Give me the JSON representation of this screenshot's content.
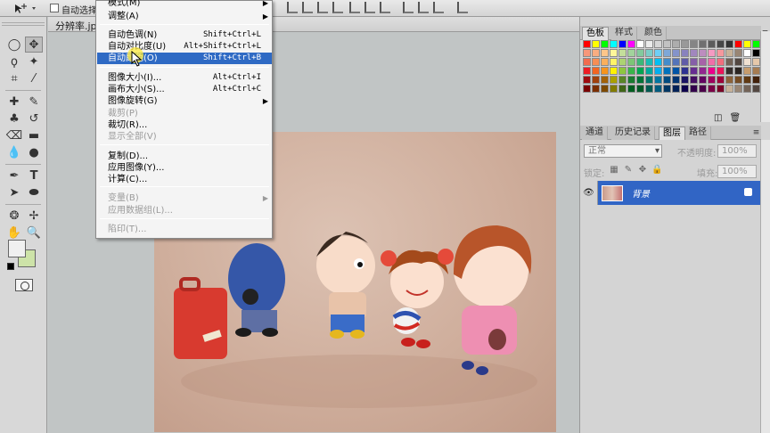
{
  "options_bar": {
    "auto_select_label": "自动选择"
  },
  "document": {
    "tab_title": "分辨率.jpg"
  },
  "image_menu": {
    "items": [
      {
        "label": "模式(M)",
        "shortcut": "",
        "submenu": true,
        "disabled": false,
        "highlight": false
      },
      {
        "label": "调整(A)",
        "shortcut": "",
        "submenu": true,
        "disabled": false,
        "highlight": false
      },
      {
        "label": "自动色调(N)",
        "shortcut": "Shift+Ctrl+L",
        "submenu": false,
        "disabled": false,
        "highlight": false
      },
      {
        "label": "自动对比度(U)",
        "shortcut": "Alt+Shift+Ctrl+L",
        "submenu": false,
        "disabled": false,
        "highlight": false
      },
      {
        "label": "自动颜色(O)",
        "shortcut": "Shift+Ctrl+B",
        "submenu": false,
        "disabled": false,
        "highlight": true
      },
      {
        "label": "图像大小(I)...",
        "shortcut": "Alt+Ctrl+I",
        "submenu": false,
        "disabled": false,
        "highlight": false
      },
      {
        "label": "画布大小(S)...",
        "shortcut": "Alt+Ctrl+C",
        "submenu": false,
        "disabled": false,
        "highlight": false
      },
      {
        "label": "图像旋转(G)",
        "shortcut": "",
        "submenu": true,
        "disabled": false,
        "highlight": false
      },
      {
        "label": "裁剪(P)",
        "shortcut": "",
        "submenu": false,
        "disabled": true,
        "highlight": false
      },
      {
        "label": "裁切(R)...",
        "shortcut": "",
        "submenu": false,
        "disabled": false,
        "highlight": false
      },
      {
        "label": "显示全部(V)",
        "shortcut": "",
        "submenu": false,
        "disabled": true,
        "highlight": false
      },
      {
        "label": "复制(D)...",
        "shortcut": "",
        "submenu": false,
        "disabled": false,
        "highlight": false
      },
      {
        "label": "应用图像(Y)...",
        "shortcut": "",
        "submenu": false,
        "disabled": false,
        "highlight": false
      },
      {
        "label": "计算(C)...",
        "shortcut": "",
        "submenu": false,
        "disabled": false,
        "highlight": false
      },
      {
        "label": "变量(B)",
        "shortcut": "",
        "submenu": true,
        "disabled": true,
        "highlight": false
      },
      {
        "label": "应用数据组(L)...",
        "shortcut": "",
        "submenu": false,
        "disabled": true,
        "highlight": false
      },
      {
        "label": "陷印(T)...",
        "shortcut": "",
        "submenu": false,
        "disabled": true,
        "highlight": false
      }
    ]
  },
  "swatch_panel": {
    "tabs": [
      "色板",
      "样式",
      "颜色"
    ],
    "active_tab": 0,
    "colors": [
      "#ff0000",
      "#ffff00",
      "#00ff00",
      "#00ffff",
      "#0000ff",
      "#ff00ff",
      "#ffffff",
      "#ebebeb",
      "#d6d6d6",
      "#c2c2c2",
      "#adadad",
      "#999999",
      "#858585",
      "#707070",
      "#5c5c5c",
      "#474747",
      "#333333",
      "#ff0000",
      "#ffff00",
      "#00ff00",
      "#f7977a",
      "#f9ad81",
      "#fdc68a",
      "#fff79a",
      "#c4df9b",
      "#a2d39c",
      "#82ca9d",
      "#7bcdc8",
      "#6ecff6",
      "#7ea7d8",
      "#8493ca",
      "#8882be",
      "#a187be",
      "#bc8dbf",
      "#f49ac2",
      "#f6989d",
      "#c7b299",
      "#998675",
      "#ffffff",
      "#000000",
      "#f26c4f",
      "#f68e55",
      "#fbaf5c",
      "#fff467",
      "#acd372",
      "#7cc576",
      "#3bb878",
      "#1abbb4",
      "#00bff3",
      "#438ccb",
      "#5574b9",
      "#605ca8",
      "#855fa8",
      "#a763a8",
      "#f06ea9",
      "#f26d7d",
      "#736357",
      "#534741",
      "#f0e1d2",
      "#e6c8aa",
      "#ed1c24",
      "#f26522",
      "#f7941d",
      "#fff200",
      "#8dc63f",
      "#39b54a",
      "#00a651",
      "#00a99d",
      "#00aeef",
      "#0072bc",
      "#0054a6",
      "#2e3192",
      "#662d91",
      "#92278f",
      "#ec008c",
      "#ed145b",
      "#362f2d",
      "#2b2522",
      "#c69c6d",
      "#a67c52",
      "#9e0b0f",
      "#a0410d",
      "#a36209",
      "#aba000",
      "#598527",
      "#1a7b30",
      "#007236",
      "#00746b",
      "#0076a3",
      "#004b80",
      "#003471",
      "#1b1464",
      "#440e62",
      "#630460",
      "#9e005d",
      "#9e0039",
      "#8c6239",
      "#754c24",
      "#603913",
      "#42210b",
      "#790000",
      "#7b2e00",
      "#7d4900",
      "#827b00",
      "#406618",
      "#005e20",
      "#005826",
      "#005952",
      "#005b7f",
      "#003663",
      "#002157",
      "#0d004c",
      "#32004b",
      "#4b0049",
      "#7b0046",
      "#7a0026",
      "#c7b299",
      "#998675",
      "#736357",
      "#534741"
    ],
    "footer_icons": [
      "new-swatch-icon",
      "delete-swatch-icon"
    ]
  },
  "layers_panel": {
    "tabs": [
      "通道",
      "历史记录",
      "图层",
      "路径"
    ],
    "active_tab": 2,
    "blend_mode": "正常",
    "opacity_label": "不透明度:",
    "opacity_value": "100%",
    "lock_label": "锁定:",
    "fill_label": "填充:",
    "fill_value": "100%",
    "layers": [
      {
        "name": "背景",
        "visible": true,
        "locked": true,
        "selected": true
      }
    ]
  }
}
